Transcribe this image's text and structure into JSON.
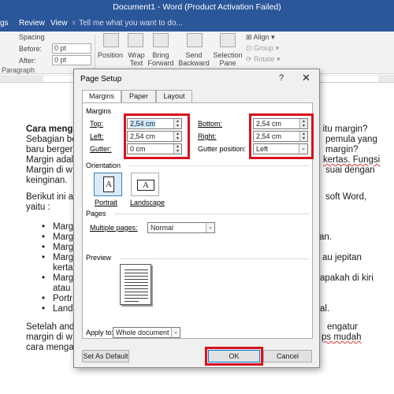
{
  "window": {
    "title": "Document1 - Word (Product Activation Failed)"
  },
  "ribbon": {
    "tabs": [
      "gs",
      "Review",
      "View"
    ],
    "tell_me": "Tell me what you want to do...",
    "spacing_label": "Spacing",
    "before_label": "Before:",
    "before_value": "0 pt",
    "after_label": "After:",
    "after_value": "0 pt",
    "position_label": "Position",
    "wrap_text_label": "Wrap Text",
    "bring_forward_label": "Bring Forward",
    "send_backward_label": "Send Backward",
    "selection_pane_label": "Selection Pane",
    "align_label": "Align",
    "group_label": "Group",
    "rotate_label": "Rotate",
    "paragraph_label": "Paragraph"
  },
  "document": {
    "line1_bold": "Cara meng",
    "line1_right": "a itu margin?",
    "line2_left": "Sebagian be",
    "line2_right": "pemula yang",
    "line3_left": "baru berger",
    "line3_right": "margin?",
    "line4_left": "Margin adal",
    "line4_right": "kertas. Fungsi",
    "line5_left": "Margin di w",
    "line5_right": "suai dengan",
    "line6_left": "keinginan.",
    "line7_left": "Berikut ini a",
    "line7_right": "soft Word,",
    "line8_left": "yaitu :",
    "bullets": [
      {
        "left": "Marg",
        "right": ""
      },
      {
        "left": "Marg",
        "right": "an."
      },
      {
        "left": "Marg",
        "right": ""
      },
      {
        "left": "Marg",
        "right": "au jepitan"
      },
      {
        "left": "kerta",
        "right": ""
      },
      {
        "left": "Marg",
        "right": "apakah di kiri"
      },
      {
        "left": "atau",
        "right": ""
      },
      {
        "left": "Portr",
        "right": ""
      },
      {
        "left": "Land",
        "right": "al."
      }
    ],
    "end1_left": "Setelah and",
    "end1_right": "engatur",
    "end2_left": "margin di w",
    "end2_right": "ps mudah",
    "end3_left": "cara menga"
  },
  "dialog": {
    "title": "Page Setup",
    "help": "?",
    "close": "✕",
    "tabs": [
      "Margins",
      "Paper",
      "Layout"
    ],
    "margins_heading": "Margins",
    "top_label": "Top:",
    "top_value": "2,54 cm",
    "left_label": "Left:",
    "left_value": "2,54 cm",
    "gutter_label": "Gutter:",
    "gutter_value": "0 cm",
    "bottom_label": "Bottom:",
    "bottom_value": "2,54 cm",
    "right_label": "Right:",
    "right_value": "2,54 cm",
    "gutter_position_label": "Gutter position:",
    "gutter_position_value": "Left",
    "orientation_heading": "Orientation",
    "portrait_label": "Portrait",
    "landscape_label": "Landscape",
    "pages_heading": "Pages",
    "multiple_pages_label": "Multiple pages:",
    "multiple_pages_value": "Normal",
    "preview_heading": "Preview",
    "apply_to_label": "Apply to:",
    "apply_to_value": "Whole document",
    "set_default_label": "Set As Default",
    "ok_label": "OK",
    "cancel_label": "Cancel"
  },
  "colors": {
    "title_bar": "#2b579a",
    "highlight_box": "#d9121d",
    "ok_border": "#0078d7"
  }
}
